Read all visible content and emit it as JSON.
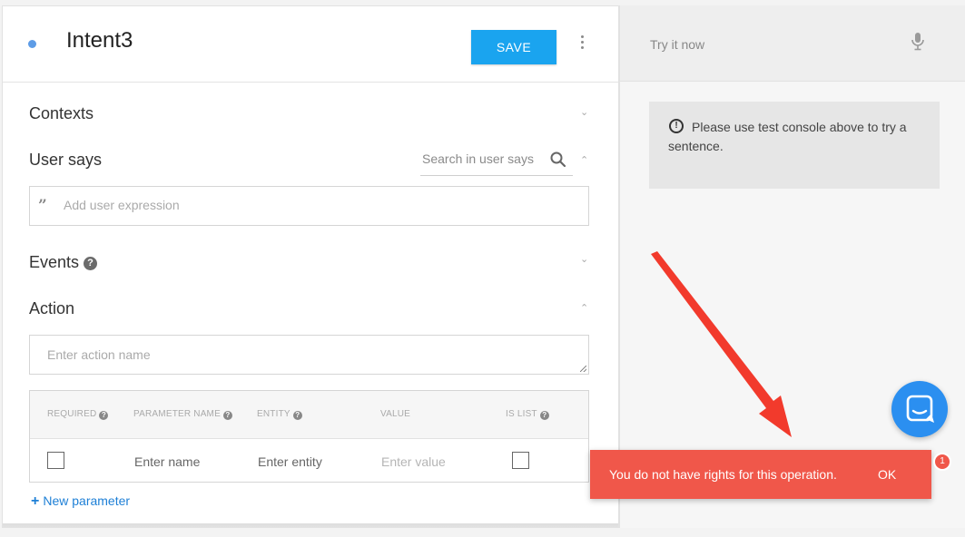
{
  "intent": {
    "title": "Intent3",
    "save_label": "SAVE"
  },
  "sections": {
    "contexts": "Contexts",
    "user_says": "User says",
    "user_says_search_placeholder": "Search in user says",
    "user_expression_placeholder": "Add user expression",
    "events": "Events",
    "action": "Action",
    "action_placeholder": "Enter action name"
  },
  "parameters": {
    "headers": [
      "REQUIRED",
      "PARAMETER NAME",
      "ENTITY",
      "VALUE",
      "IS LIST"
    ],
    "row": {
      "name_placeholder": "Enter name",
      "entity_placeholder": "Enter entity",
      "value_placeholder": "Enter value"
    },
    "new_label": "New parameter"
  },
  "console": {
    "placeholder": "Try it now",
    "info": "Please use test console above to try a sentence."
  },
  "toast": {
    "message": "You do not have rights for this operation.",
    "ok_label": "OK",
    "badge_count": "1"
  },
  "colors": {
    "accent": "#1aa4ef",
    "toast": "#f0574a",
    "chat": "#2b8ff0",
    "arrow": "#f23a2c"
  }
}
